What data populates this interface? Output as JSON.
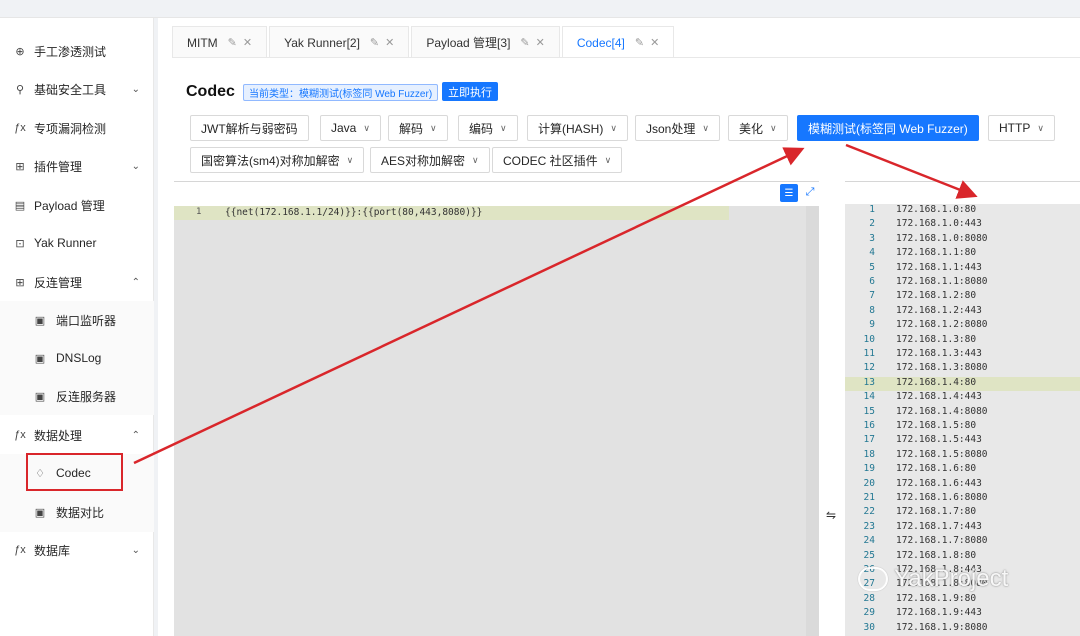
{
  "sidebar": {
    "items": [
      {
        "label": "手工渗透测试",
        "icon": "crosshair-icon",
        "arrow": ""
      },
      {
        "label": "基础安全工具",
        "icon": "tool-icon",
        "arrow": "⌄"
      },
      {
        "label": "专项漏洞检测",
        "icon": "fx-icon",
        "arrow": ""
      },
      {
        "label": "插件管理",
        "icon": "grid-icon",
        "arrow": "⌄"
      },
      {
        "label": "Payload 管理",
        "icon": "payload-icon",
        "arrow": ""
      },
      {
        "label": "Yak Runner",
        "icon": "terminal-icon",
        "arrow": ""
      },
      {
        "label": "反连管理",
        "icon": "grid-icon",
        "arrow": "⌃"
      },
      {
        "label": "端口监听器",
        "icon": "box-icon",
        "arrow": ""
      },
      {
        "label": "DNSLog",
        "icon": "box-icon",
        "arrow": ""
      },
      {
        "label": "反连服务器",
        "icon": "box-icon",
        "arrow": ""
      },
      {
        "label": "数据处理",
        "icon": "fx-icon",
        "arrow": "⌃"
      },
      {
        "label": "Codec",
        "icon": "flame-icon",
        "arrow": ""
      },
      {
        "label": "数据对比",
        "icon": "box-icon",
        "arrow": ""
      },
      {
        "label": "数据库",
        "icon": "fx-icon",
        "arrow": "⌄"
      }
    ]
  },
  "tabs": [
    {
      "label": "MITM",
      "active": false
    },
    {
      "label": "Yak Runner[2]",
      "active": false
    },
    {
      "label": "Payload 管理[3]",
      "active": false
    },
    {
      "label": "Codec[4]",
      "active": true
    }
  ],
  "header": {
    "title": "Codec",
    "type_tag": "当前类型：模糊测试(标签同 Web Fuzzer)",
    "run_label": "立即执行"
  },
  "toolbar": {
    "row1": [
      {
        "label": "JWT解析与弱密码",
        "dropdown": false,
        "primary": false
      },
      {
        "label": "Java",
        "dropdown": true,
        "primary": false
      },
      {
        "label": "解码",
        "dropdown": true,
        "primary": false
      },
      {
        "label": "编码",
        "dropdown": true,
        "primary": false
      },
      {
        "label": "计算(HASH)",
        "dropdown": true,
        "primary": false
      },
      {
        "label": "Json处理",
        "dropdown": true,
        "primary": false
      },
      {
        "label": "美化",
        "dropdown": true,
        "primary": false
      },
      {
        "label": "模糊测试(标签同 Web Fuzzer)",
        "dropdown": false,
        "primary": true
      },
      {
        "label": "HTTP",
        "dropdown": true,
        "primary": false
      }
    ],
    "row2": [
      {
        "label": "国密算法(sm4)对称加解密",
        "dropdown": true
      },
      {
        "label": "AES对称加解密",
        "dropdown": true
      },
      {
        "label": "CODEC 社区插件",
        "dropdown": true
      }
    ]
  },
  "input_editor": {
    "line_number": "1",
    "content": "{{net(172.168.1.1/24)}}:{{port(80,443,8080)}}"
  },
  "output_editor": {
    "highlight_line": 13,
    "lines": [
      "172.168.1.0:80",
      "172.168.1.0:443",
      "172.168.1.0:8080",
      "172.168.1.1:80",
      "172.168.1.1:443",
      "172.168.1.1:8080",
      "172.168.1.2:80",
      "172.168.1.2:443",
      "172.168.1.2:8080",
      "172.168.1.3:80",
      "172.168.1.3:443",
      "172.168.1.3:8080",
      "172.168.1.4:80",
      "172.168.1.4:443",
      "172.168.1.4:8080",
      "172.168.1.5:80",
      "172.168.1.5:443",
      "172.168.1.5:8080",
      "172.168.1.6:80",
      "172.168.1.6:443",
      "172.168.1.6:8080",
      "172.168.1.7:80",
      "172.168.1.7:443",
      "172.168.1.7:8080",
      "172.168.1.8:80",
      "172.168.1.8:443",
      "172.168.1.8:8080",
      "172.168.1.9:80",
      "172.168.1.9:443",
      "172.168.1.9:8080"
    ]
  },
  "watermark": "YakProject",
  "colors": {
    "accent": "#1677ff",
    "annotation": "#d9262b"
  }
}
